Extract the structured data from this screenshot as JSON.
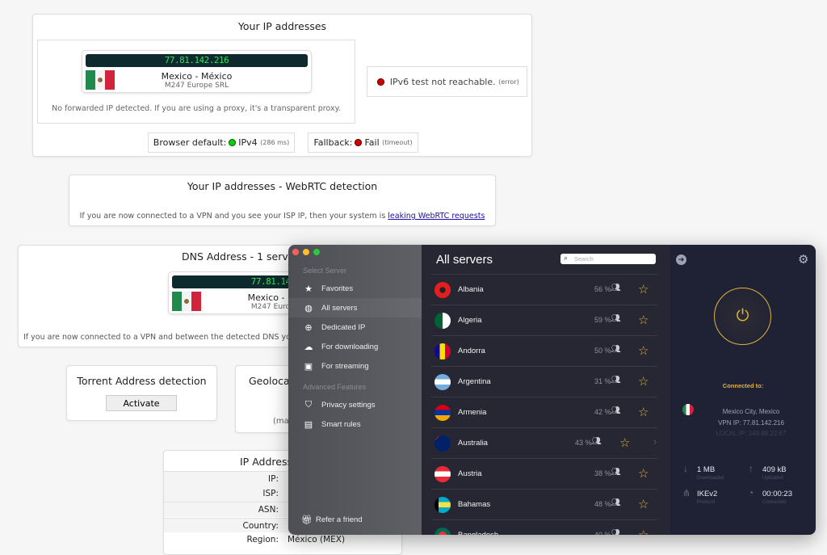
{
  "ip_card": {
    "title": "Your IP addresses",
    "ip": "77.81.142.216",
    "country": "Mexico - México",
    "isp": "M247 Europe SRL",
    "forward_note": "No forwarded IP detected. If you are using a proxy, it's a transparent proxy.",
    "ipv6": "IPv6 test not reachable.",
    "ipv6_note": "(error)",
    "browser_default_label": "Browser default:",
    "browser_default_value": "IPv4",
    "browser_default_time": "(286 ms)",
    "fallback_label": "Fallback:",
    "fallback_value": "Fail",
    "fallback_note": "(timeout)"
  },
  "webrtc_card": {
    "title": "Your IP addresses - WebRTC detection",
    "text": "If you are now connected to a VPN and you see your ISP IP, then your system is ",
    "link": "leaking WebRTC requests"
  },
  "dns_card": {
    "title": "DNS Address - 1 server",
    "ip": "77.81.142.216",
    "country": "Mexico - México",
    "isp": "M247 Europe SRL",
    "text": "If you are now connected to a VPN and between the detected DNS you see your ISP DNS, then your system is leaking DNS requests"
  },
  "torrent_card": {
    "title": "Torrent Address detection",
    "button": "Activate"
  },
  "geo_card": {
    "title": "Geolocation map",
    "note": "(map)"
  },
  "ip_details": {
    "title": "IP Address details",
    "rows": [
      {
        "label": "IP:",
        "value": ""
      },
      {
        "label": "ISP:",
        "value": ""
      },
      {
        "label": "ASN:",
        "value": ""
      },
      {
        "label": "Country:",
        "value": ""
      },
      {
        "label": "Region:",
        "value": "México (MEX)"
      }
    ]
  },
  "vpn": {
    "sidebar": {
      "section1": "Select Server",
      "items": [
        {
          "label": "Favorites",
          "icon": "star-icon"
        },
        {
          "label": "All servers",
          "icon": "globe-icon"
        },
        {
          "label": "Dedicated IP",
          "icon": "globe-grid-icon"
        },
        {
          "label": "For downloading",
          "icon": "cloud-download-icon"
        },
        {
          "label": "For streaming",
          "icon": "play-screen-icon"
        }
      ],
      "section2": "Advanced Features",
      "items2": [
        {
          "label": "Privacy settings",
          "icon": "shield-check-icon"
        },
        {
          "label": "Smart rules",
          "icon": "rules-icon"
        }
      ],
      "refer": "Refer a friend"
    },
    "list": {
      "title": "All servers",
      "search_placeholder": "Search",
      "servers": [
        {
          "name": "Albania",
          "load": "56 %"
        },
        {
          "name": "Algeria",
          "load": "59 %"
        },
        {
          "name": "Andorra",
          "load": "50 %"
        },
        {
          "name": "Argentina",
          "load": "31 %"
        },
        {
          "name": "Armenia",
          "load": "42 %"
        },
        {
          "name": "Australia",
          "load": "43 %"
        },
        {
          "name": "Austria",
          "load": "38 %"
        },
        {
          "name": "Bahamas",
          "load": "48 %"
        },
        {
          "name": "Bangladesh",
          "load": "40 %"
        }
      ]
    },
    "status": {
      "connected_label": "Connected to:",
      "location": "Mexico City, Mexico",
      "vpn_ip": "VPN IP: 77.81.142.216",
      "local_ip": "LOCAL IP: 149.88.22.67",
      "downloaded": "1 MB",
      "downloaded_label": "Downloaded",
      "uploaded": "409 kB",
      "uploaded_label": "Uploaded",
      "protocol": "IKEv2",
      "protocol_label": "Protocol",
      "time": "00:00:23",
      "time_label": "Connected"
    },
    "colors": {
      "accent": "#e3b23c",
      "list_bg": "#262733",
      "panel_bg": "#1f2135"
    }
  }
}
